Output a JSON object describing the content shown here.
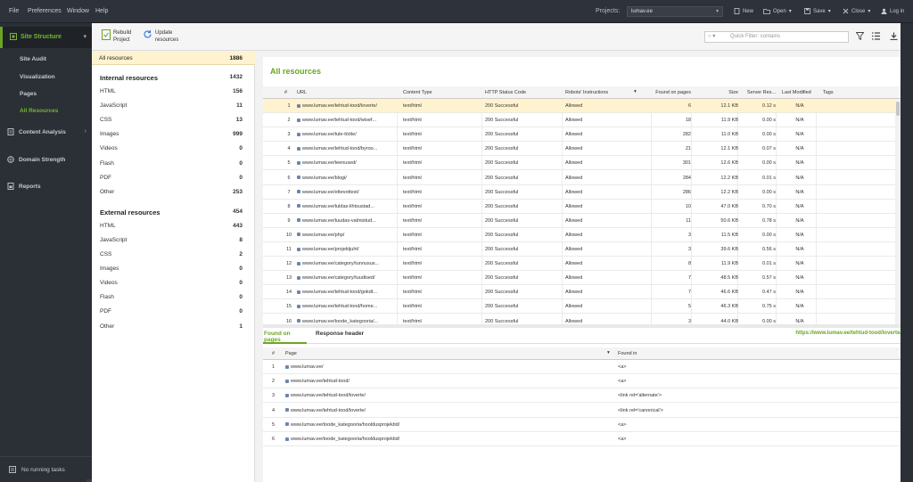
{
  "menu": [
    "File",
    "Preferences",
    "Window",
    "Help"
  ],
  "projects": {
    "label": "Projects:",
    "value": "lumav.ee"
  },
  "topbar": {
    "new": "New",
    "open": "Open",
    "save": "Save",
    "close": "Close",
    "login": "Log in"
  },
  "sidebar": {
    "site_structure": "Site Structure",
    "subitems": [
      "Site Audit",
      "Visualization",
      "Pages",
      "All Resources"
    ],
    "content_analysis": "Content Analysis",
    "domain_strength": "Domain Strength",
    "reports": "Reports",
    "tasks": "No running tasks"
  },
  "toolbar": {
    "rebuild": "Rebuild\nProject",
    "update": "Update\nresources",
    "filter_prefix": "▾",
    "filter_placeholder": "Quick Filter: contains"
  },
  "left": {
    "all": {
      "label": "All resources",
      "count": "1886"
    },
    "internal": {
      "label": "Internal resources",
      "count": "1432"
    },
    "internal_items": [
      {
        "label": "HTML",
        "count": "156"
      },
      {
        "label": "JavaScript",
        "count": "11"
      },
      {
        "label": "CSS",
        "count": "13"
      },
      {
        "label": "Images",
        "count": "999"
      },
      {
        "label": "Videos",
        "count": "0"
      },
      {
        "label": "Flash",
        "count": "0"
      },
      {
        "label": "PDF",
        "count": "0"
      },
      {
        "label": "Other",
        "count": "253"
      }
    ],
    "external": {
      "label": "External resources",
      "count": "454"
    },
    "external_items": [
      {
        "label": "HTML",
        "count": "443"
      },
      {
        "label": "JavaScript",
        "count": "8"
      },
      {
        "label": "CSS",
        "count": "2"
      },
      {
        "label": "Images",
        "count": "0"
      },
      {
        "label": "Videos",
        "count": "0"
      },
      {
        "label": "Flash",
        "count": "0"
      },
      {
        "label": "PDF",
        "count": "0"
      },
      {
        "label": "Other",
        "count": "1"
      }
    ]
  },
  "grid": {
    "title": "All resources",
    "columns": [
      "#",
      "URL",
      "Content Type",
      "HTTP Status Code",
      "Robots' Instructions",
      "Found on pages",
      "Size",
      "Server Res...",
      "Last Modified",
      "Tags"
    ],
    "rows": [
      [
        "1",
        "www.lumav.ee/tehtud-tood/loverte/",
        "text/html",
        "200 Successful",
        "Allowed",
        "6",
        "12.1 KB",
        "0.12 s",
        "N/A"
      ],
      [
        "2",
        "www.lumav.ee/tehtud-tood/wisef...",
        "text/html",
        "200 Successful",
        "Allowed",
        "18",
        "11.9 KB",
        "0.00 s",
        "N/A"
      ],
      [
        "3",
        "www.lumav.ee/tule-tööle/",
        "text/html",
        "200 Successful",
        "Allowed",
        "282",
        "11.0 KB",
        "0.00 s",
        "N/A"
      ],
      [
        "4",
        "www.lumav.ee/tehtud-tood/byroo...",
        "text/html",
        "200 Successful",
        "Allowed",
        "21",
        "12.1 KB",
        "0.07 s",
        "N/A"
      ],
      [
        "5",
        "www.lumav.ee/teenused/",
        "text/html",
        "200 Successful",
        "Allowed",
        "301",
        "12.6 KB",
        "0.00 s",
        "N/A"
      ],
      [
        "6",
        "www.lumav.ee/blogi/",
        "text/html",
        "200 Successful",
        "Allowed",
        "284",
        "12.2 KB",
        "0.01 s",
        "N/A"
      ],
      [
        "7",
        "www.lumav.ee/ettevottest/",
        "text/html",
        "200 Successful",
        "Allowed",
        "286",
        "12.2 KB",
        "0.00 s",
        "N/A"
      ],
      [
        "8",
        "www.lumav.ee/tuldas-lihtsustad...",
        "text/html",
        "200 Successful",
        "Allowed",
        "10",
        "47.0 KB",
        "0.70 s",
        "N/A"
      ],
      [
        "9",
        "www.lumav.ee/tuudas-valmistud...",
        "text/html",
        "200 Successful",
        "Allowed",
        "11",
        "50.6 KB",
        "0.78 s",
        "N/A"
      ],
      [
        "10",
        "www.lumav.ee/php/",
        "text/html",
        "200 Successful",
        "Allowed",
        "3",
        "11.5 KB",
        "0.00 s",
        "N/A"
      ],
      [
        "11",
        "www.lumav.ee/projektjuht/",
        "text/html",
        "200 Successful",
        "Allowed",
        "3",
        "39.6 KB",
        "0.56 s",
        "N/A"
      ],
      [
        "12",
        "www.lumav.ee/category/tunnusus...",
        "text/html",
        "200 Successful",
        "Allowed",
        "8",
        "11.9 KB",
        "0.01 s",
        "N/A"
      ],
      [
        "13",
        "www.lumav.ee/category/tuudised/",
        "text/html",
        "200 Successful",
        "Allowed",
        "7",
        "48.5 KB",
        "0.57 s",
        "N/A"
      ],
      [
        "14",
        "www.lumav.ee/tehtud-tood/gokdt...",
        "text/html",
        "200 Successful",
        "Allowed",
        "7",
        "46.6 KB",
        "0.47 s",
        "N/A"
      ],
      [
        "15",
        "www.lumav.ee/tehtud-tood/home...",
        "text/html",
        "200 Successful",
        "Allowed",
        "5",
        "46.3 KB",
        "0.75 s",
        "N/A"
      ],
      [
        "16",
        "www.lumav.ee/toode_kategooria/...",
        "text/html",
        "200 Successful",
        "Allowed",
        "3",
        "44.0 KB",
        "0.00 s",
        "N/A"
      ]
    ]
  },
  "bottom": {
    "tabs": [
      "Found on pages",
      "Response header"
    ],
    "selected_url": "https://www.lumav.ee/tehtud-tood/loverte/",
    "columns": [
      "#",
      "Page",
      "Found in"
    ],
    "rows": [
      [
        "1",
        "www.lumav.ee/",
        "<a>"
      ],
      [
        "2",
        "www.lumav.ee/tehtud-tood/",
        "<a>"
      ],
      [
        "3",
        "www.lumav.ee/tehtud-tood/loverte/",
        "<link rel='alternate'>"
      ],
      [
        "4",
        "www.lumav.ee/tehtud-tood/loverte/",
        "<link rel='canonical'>"
      ],
      [
        "5",
        "www.lumav.ee/toode_kategooria/hooldusprojektid/",
        "<a>"
      ],
      [
        "6",
        "www.lumav.ee/toode_kategooria/hooldusprojektid/",
        "<a>"
      ]
    ]
  },
  "colors": {
    "accent": "#6aa522",
    "link": "#2561a3",
    "selected_row": "#fff3cf",
    "dark_bg": "#2b2f36"
  }
}
